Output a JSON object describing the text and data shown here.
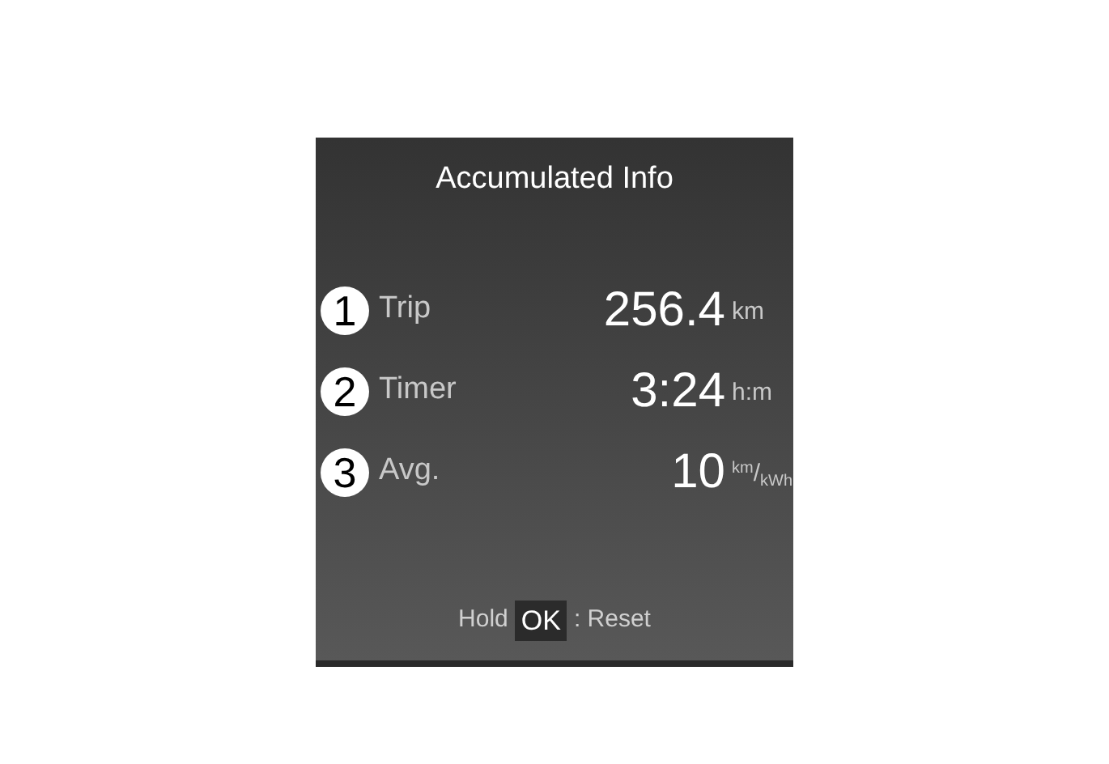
{
  "title": "Accumulated Info",
  "rows": [
    {
      "number": "1",
      "label": "Trip",
      "value": "256.4",
      "unit": "km"
    },
    {
      "number": "2",
      "label": "Timer",
      "value": "3:24",
      "unit": "h:m"
    },
    {
      "number": "3",
      "label": "Avg.",
      "value": "10",
      "unit": "$^{km}$/$_{kWh}$"
    }
  ],
  "footer": {
    "before": "Hold",
    "key": "OK",
    "after": ": Reset"
  }
}
